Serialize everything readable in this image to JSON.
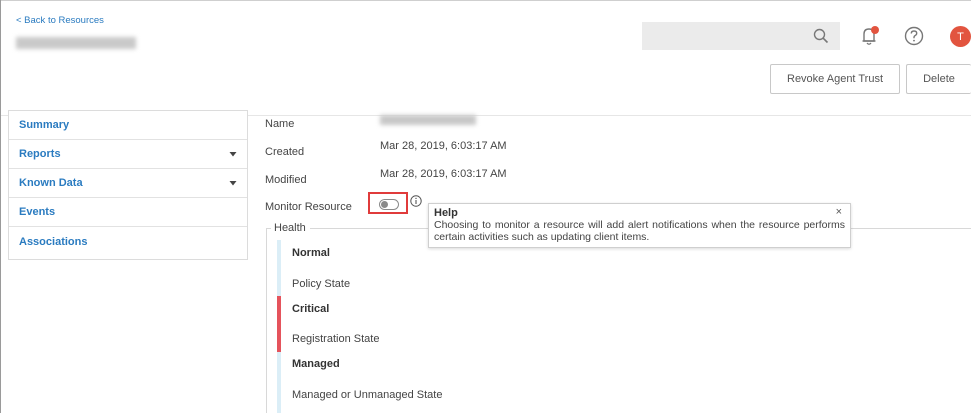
{
  "header": {
    "back_link": "< Back to Resources",
    "avatar_initial": "T"
  },
  "toolbar": {
    "revoke_label": "Revoke Agent Trust",
    "delete_label": "Delete"
  },
  "sidebar": {
    "items": [
      {
        "label": "Summary",
        "has_dropdown": false
      },
      {
        "label": "Reports",
        "has_dropdown": true
      },
      {
        "label": "Known Data",
        "has_dropdown": true
      },
      {
        "label": "Events",
        "has_dropdown": false
      },
      {
        "label": "Associations",
        "has_dropdown": false
      }
    ]
  },
  "details": {
    "name_label": "Name",
    "created_label": "Created",
    "created_value": "Mar 28, 2019, 6:03:17 AM",
    "modified_label": "Modified",
    "modified_value": "Mar 28, 2019, 6:03:17 AM",
    "monitor_label": "Monitor Resource",
    "monitor_enabled": false
  },
  "tooltip": {
    "title": "Help",
    "body": "Choosing to monitor a resource will add alert notifications when the resource performs certain activities such as updating client items.",
    "close": "×"
  },
  "health": {
    "legend": "Health",
    "sections": [
      {
        "status": "Normal",
        "sub": "Policy State",
        "color": "#dbeef7"
      },
      {
        "status": "Critical",
        "sub": "Registration State",
        "color": "#e5535c"
      },
      {
        "status": "Managed",
        "sub": "Managed or Unmanaged State",
        "color": "#dbeef7"
      }
    ]
  },
  "colors": {
    "link": "#2a7bc0",
    "avatar": "#e2543f",
    "bell_badge": "#e2543f",
    "highlight": "#e03b3b",
    "critical": "#e5535c",
    "normal": "#dbeef7"
  },
  "icons": [
    "search-icon",
    "bell-icon",
    "help-circle-icon",
    "info-icon",
    "chevron-down-icon",
    "close-icon"
  ]
}
